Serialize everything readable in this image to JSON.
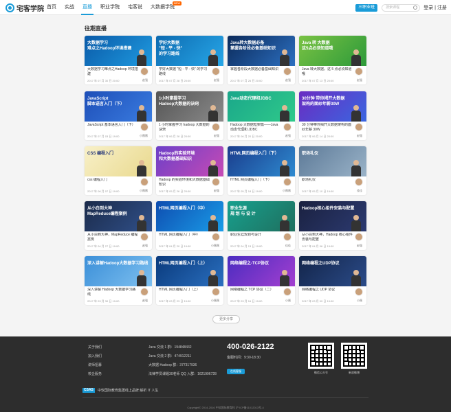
{
  "header": {
    "logo_text": "宅客学院",
    "nav": [
      {
        "label": "首页",
        "active": false
      },
      {
        "label": "实战",
        "active": false
      },
      {
        "label": "直播",
        "active": true
      },
      {
        "label": "职业学院",
        "active": false
      },
      {
        "label": "宅客说",
        "active": false
      },
      {
        "label": "大数据学院",
        "active": false,
        "badge": "NEW"
      }
    ],
    "program_button": "三职业班",
    "search_placeholder": "搜索课程",
    "login": "登录",
    "separator": "|",
    "register": "注册"
  },
  "section_title": "往期直播",
  "cards": [
    {
      "title": "大数据学习难点之Hadoop 环境搭建",
      "time": "2017 年 07 月 30 日 20:00",
      "teacher": "赵强",
      "thumb_title": "大数据学习\n难点之Hadoop环境搭建",
      "thumb_sub": "",
      "bg": "linear-gradient(135deg,#0a5aa8,#1f9be0)"
    },
    {
      "title": "学好大数据 \"短 - 平 - 快\" 的学习路线",
      "time": "2017 年 07 月 28 日 20:00",
      "teacher": "赵强",
      "thumb_title": "学好大数据\n\"短 - 平 - 快\"\n的学习路线",
      "thumb_sub": "",
      "bg": "linear-gradient(135deg,#0d6ab0,#27a7e8)"
    },
    {
      "title": "掌握各阶段大数据必备基础知识",
      "time": "2017 年 07 月 26 日 20:00",
      "teacher": "赵强",
      "thumb_title": "Java转大数据必备\n掌握各阶段必备基础知识",
      "thumb_sub": "",
      "bg": "linear-gradient(135deg,#0b2a5a,#2c6fc0)"
    },
    {
      "title": "Java 转大数据，这 5 点必须知道哦",
      "time": "2017 年 07 月 13 日 20:00",
      "teacher": "赵强",
      "thumb_title": "Java 转 大数据\n这5点必须知道哦",
      "thumb_sub": "",
      "bg": "linear-gradient(135deg,#79c243,#2d9a3a)"
    },
    {
      "title": "JavaScript 基本语言入门（下）",
      "time": "2017 年 07 月 03 日 19:00",
      "teacher": "小薇薇",
      "thumb_title": "JavaScript\n脚本语言入门（下）",
      "thumb_sub": "",
      "bg": "linear-gradient(135deg,#1e4fb8,#3a7ce0)"
    },
    {
      "title": "1 小时掌握学习 hadoop 大数据的诀窍",
      "time": "2017 年 06 月 28 日 20:00",
      "teacher": "赵强",
      "thumb_title": "1小时掌握学习\nHadoop大数据的诀窍",
      "thumb_sub": "",
      "bg": "linear-gradient(135deg,#555,#8a8a8a)"
    },
    {
      "title": "Hadoop 大数据框架篇——Java 动态代理和 JDBC",
      "time": "2017 年 06 月 20 日 20:00",
      "teacher": "赵强",
      "thumb_title": "Java动态代理和JDBC",
      "thumb_sub": "",
      "bg": "linear-gradient(135deg,#1aa78a,#2fc98a)"
    },
    {
      "title": "30 分钟带你揭开大数据架构的面纱年薪 30W",
      "time": "2017 年 06 月 14 日 20:00",
      "teacher": "赵强",
      "thumb_title": "30分钟 带你揭开大数据\n架构的面纱年薪30W",
      "thumb_sub": "",
      "bg": "linear-gradient(135deg,#6a2cc2,#3a66e0)"
    },
    {
      "title": "css 编程入门",
      "time": "2017 年 06 月 07 日 19:00",
      "teacher": "小薇薇",
      "thumb_title": "CSS 编程入门",
      "thumb_sub": "",
      "bg": "linear-gradient(135deg,#f8f0c8,#e9d98e)"
    },
    {
      "title": "Hadoop 的实验环境和大数据基础知识",
      "time": "2017 年 05 月 26 日 20:00",
      "teacher": "赵强",
      "thumb_title": "Hadoop的实验环境\n和大数据基础知识",
      "thumb_sub": "",
      "bg": "linear-gradient(135deg,#6c3fc8,#c74bb5)"
    },
    {
      "title": "HTML 网页编程入门（下）",
      "time": "2017 年 05 月 18 日 19:00",
      "teacher": "小薇薇",
      "thumb_title": "HTML网页编程入门（下）",
      "thumb_sub": "",
      "bg": "linear-gradient(135deg,#1a3c8c,#2e8ad0)"
    },
    {
      "title": "职场礼仪",
      "time": "2017 年 05 月 10 日 19:00",
      "teacher": "佳佳",
      "thumb_title": "职场礼仪",
      "thumb_sub": "",
      "bg": "linear-gradient(135deg,#5d7a98,#9ab3c8)"
    },
    {
      "title": "从小白到大神，MapReduce 编程案例",
      "time": "2017 年 04 月 27 日 19:00",
      "teacher": "赵强",
      "thumb_title": "从小白到大神\nMapReduce编程案例",
      "thumb_sub": "",
      "bg": "linear-gradient(135deg,#1b2b4a,#30508a)"
    },
    {
      "title": "HTML 网页编程入门（中）",
      "time": "2017 年 04 月 20 日 19:00",
      "teacher": "小薇薇",
      "thumb_title": "HTML网页编程入门（中）",
      "thumb_sub": "",
      "bg": "linear-gradient(135deg,#0e4db0,#1a9ce8)"
    },
    {
      "title": "职业生涯规划与设计",
      "time": "2017 年 04 月 13 日 19:00",
      "teacher": "佳佳",
      "thumb_title": "职业生涯\n规 划 与 设 计",
      "thumb_sub": "",
      "bg": "linear-gradient(135deg,#17a08e,#1f6f5e)"
    },
    {
      "title": "从小白到大神，Hadoop 核心组件安装与配置",
      "time": "2017 年 04 月 06 日 19:00",
      "teacher": "赵强",
      "thumb_title": "Hadoop核心组件安装与配置",
      "thumb_sub": "",
      "bg": "linear-gradient(135deg,#1a2140,#2c3a70)"
    },
    {
      "title": "深入讲解 Hadoop 大数据学习路线",
      "time": "2017 年 03 月 30 日 19:00",
      "teacher": "赵强",
      "thumb_title": "深入讲解Hadoop大数据学习路线",
      "thumb_sub": "",
      "bg": "linear-gradient(135deg,#3b8fd8,#7ec0f0)"
    },
    {
      "title": "HTML 网页编程入门（上）",
      "time": "2017 年 03 月 23 日 19:00",
      "teacher": "小薇薇",
      "thumb_title": "HTML网页编程入门（上）",
      "thumb_sub": "",
      "bg": "linear-gradient(135deg,#0a3a7c,#2a6fbf)"
    },
    {
      "title": "网络编程之 TCP 协议（二）",
      "time": "2017 年 03 月 16 日 19:00",
      "teacher": "小薇",
      "thumb_title": "网络编程之-TCP协议",
      "thumb_sub": "",
      "bg": "linear-gradient(135deg,#4b2cc0,#a33fd0)"
    },
    {
      "title": "网络编程之 UDP 协议",
      "time": "2017 年 03 月 09 日 19:00",
      "teacher": "小薇",
      "thumb_title": "网络编程之UDP协议",
      "thumb_sub": "",
      "bg": "linear-gradient(135deg,#13254a,#2b4b88)"
    }
  ],
  "more_button": "更多分享",
  "footer": {
    "links": [
      "关于我们",
      "加入我们",
      "讲师招募",
      "校企服务"
    ],
    "groups": [
      "Java 交流 1 群：194848432",
      "Java 交流 2 群：474912211",
      "大数据 Hadoop 群：377317936",
      "法律学员课题30老师 QQ 入群：1621996728"
    ],
    "phone": "400-026-2122",
    "hours": "客服时间：9:30-18:30",
    "service_button": "在线客服",
    "qr_labels": [
      "微信公众号",
      "新浪微博"
    ],
    "logo_text": "CSAS",
    "slogan": "中软国际教育集团线上品牌 解析 IT 人生",
    "copyright": "Copyright© 2014-2016 中软国际教育科 沪 ICP备11012013号-4"
  },
  "colors": {
    "accent": "#1a9cd8",
    "footer_bg": "#2d2d2d"
  }
}
